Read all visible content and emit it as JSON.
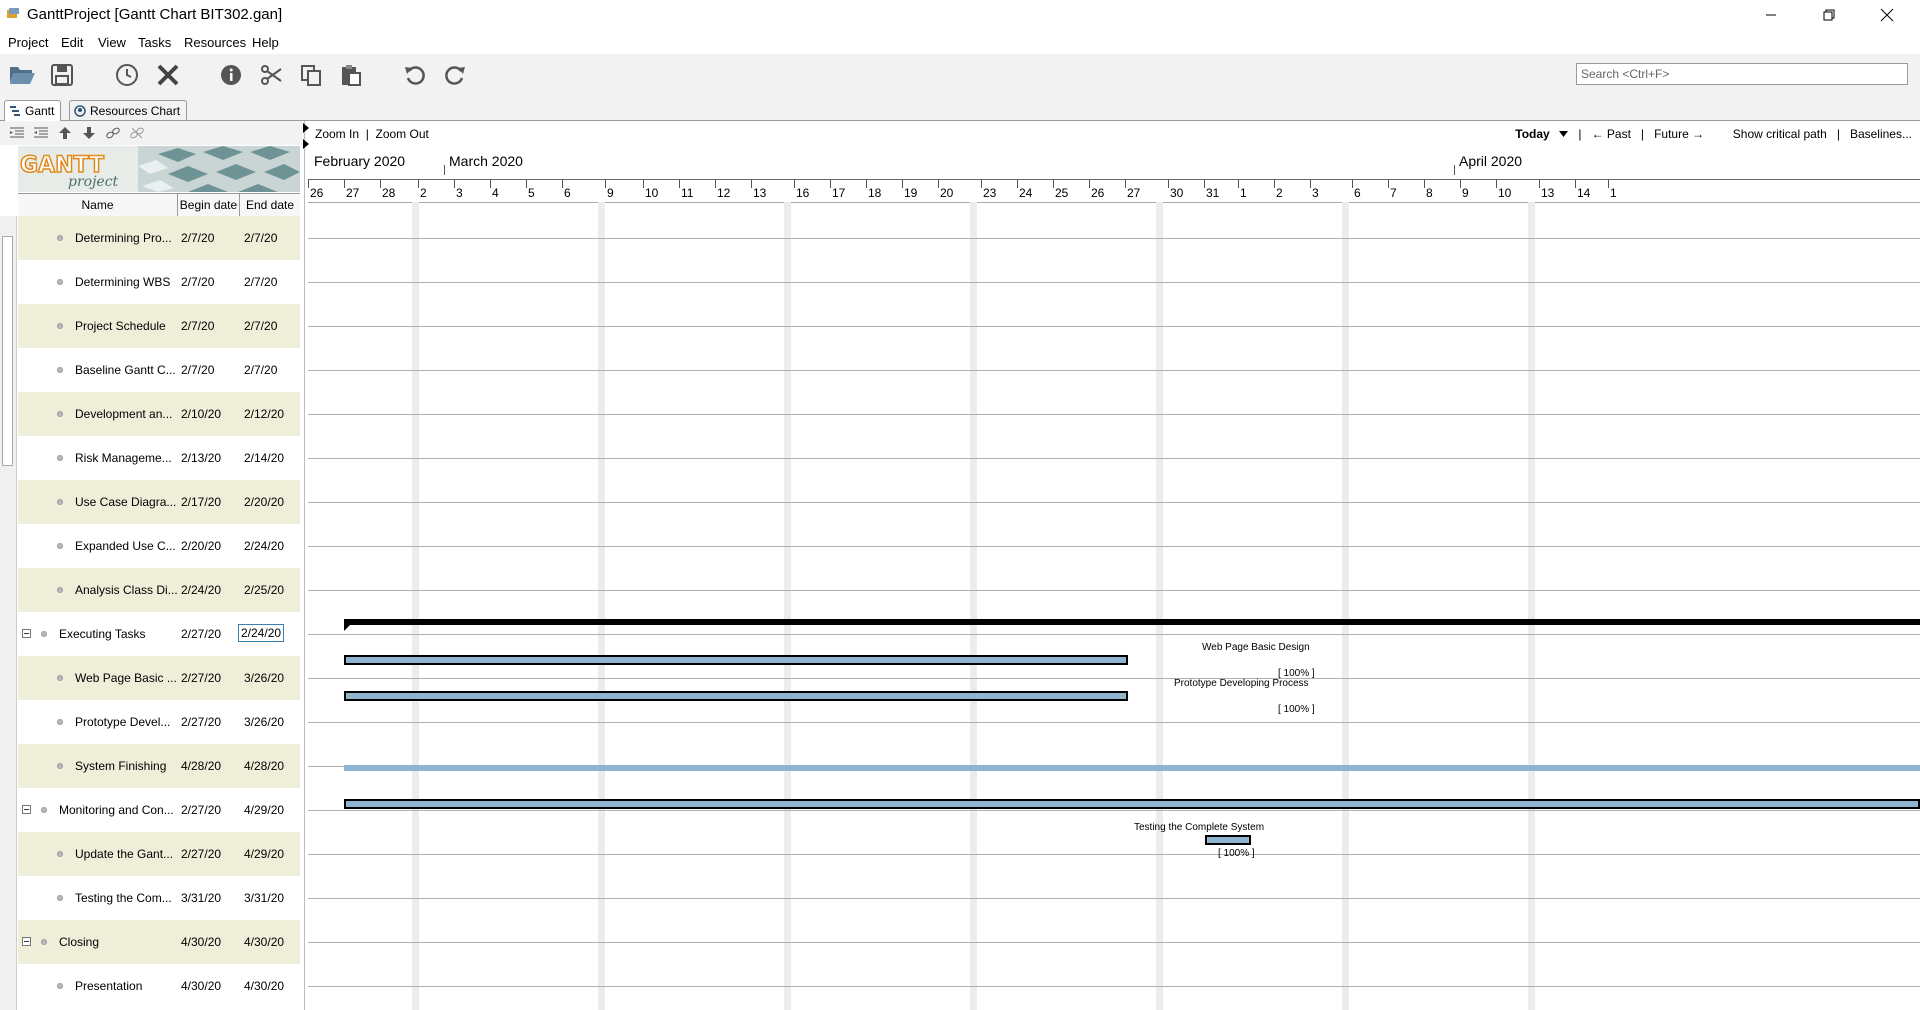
{
  "window": {
    "title": "GanttProject [Gantt Chart BIT302.gan]"
  },
  "menu": [
    "Project",
    "Edit",
    "View",
    "Tasks",
    "Resources",
    "Help"
  ],
  "toolbar": {
    "buttons": [
      "open-icon",
      "save-icon",
      "history-icon",
      "delete-icon",
      "info-icon",
      "cut-icon",
      "copy-icon",
      "paste-icon",
      "undo-icon",
      "redo-icon"
    ],
    "search_placeholder": "Search <Ctrl+F>"
  },
  "tabs": [
    {
      "label": "Gantt",
      "active": true
    },
    {
      "label": "Resources Chart",
      "active": false
    }
  ],
  "logo": {
    "main": "GANTT",
    "sub": "project"
  },
  "table": {
    "headers": {
      "name": "Name",
      "begin": "Begin date",
      "end": "End date"
    },
    "rows": [
      {
        "name": "Determining Pro...",
        "begin": "2/7/20",
        "end": "2/7/20",
        "level": 1
      },
      {
        "name": "Determining WBS",
        "begin": "2/7/20",
        "end": "2/7/20",
        "level": 1
      },
      {
        "name": "Project Schedule",
        "begin": "2/7/20",
        "end": "2/7/20",
        "level": 1
      },
      {
        "name": "Baseline Gantt C...",
        "begin": "2/7/20",
        "end": "2/7/20",
        "level": 1
      },
      {
        "name": "Development an...",
        "begin": "2/10/20",
        "end": "2/12/20",
        "level": 1
      },
      {
        "name": "Risk Manageme...",
        "begin": "2/13/20",
        "end": "2/14/20",
        "level": 1
      },
      {
        "name": "Use Case Diagra...",
        "begin": "2/17/20",
        "end": "2/20/20",
        "level": 1
      },
      {
        "name": "Expanded Use C...",
        "begin": "2/20/20",
        "end": "2/24/20",
        "level": 1
      },
      {
        "name": "Analysis Class Di...",
        "begin": "2/24/20",
        "end": "2/25/20",
        "level": 1
      },
      {
        "name": "Executing Tasks",
        "begin": "2/27/20",
        "end": "2/24/20",
        "level": 0,
        "editing_end": true
      },
      {
        "name": "Web Page Basic ...",
        "begin": "2/27/20",
        "end": "3/26/20",
        "level": 1
      },
      {
        "name": "Prototype Devel...",
        "begin": "2/27/20",
        "end": "3/26/20",
        "level": 1
      },
      {
        "name": "System Finishing",
        "begin": "4/28/20",
        "end": "4/28/20",
        "level": 1
      },
      {
        "name": "Monitoring and Con...",
        "begin": "2/27/20",
        "end": "4/29/20",
        "level": 0
      },
      {
        "name": "Update the Gant...",
        "begin": "2/27/20",
        "end": "4/29/20",
        "level": 1
      },
      {
        "name": "Testing the Com...",
        "begin": "3/31/20",
        "end": "3/31/20",
        "level": 1
      },
      {
        "name": "Closing",
        "begin": "4/30/20",
        "end": "4/30/20",
        "level": 0
      },
      {
        "name": "Presentation",
        "begin": "4/30/20",
        "end": "4/30/20",
        "level": 1
      }
    ]
  },
  "chart": {
    "zoom_in": "Zoom In",
    "zoom_out": "Zoom Out",
    "today": "Today",
    "past": "← Past",
    "future": "Future →",
    "critical": "Show critical path",
    "baselines": "Baselines...",
    "months": [
      "February 2020",
      "March 2020",
      "April 2020"
    ],
    "days": [
      "26",
      "27",
      "28",
      "2",
      "3",
      "4",
      "5",
      "6",
      "9",
      "10",
      "11",
      "12",
      "13",
      "16",
      "17",
      "18",
      "19",
      "20",
      "23",
      "24",
      "25",
      "26",
      "27",
      "30",
      "31",
      "1",
      "2",
      "3",
      "6",
      "7",
      "8",
      "9",
      "10",
      "13",
      "14",
      "1"
    ],
    "bars": [
      {
        "label": "Web Page Basic Design",
        "percent": "[ 100% ]"
      },
      {
        "label": "Prototype Developing Process",
        "percent": "[ 100% ]"
      },
      {
        "label": "Testing the Complete System",
        "percent": "[ 100% ]"
      }
    ]
  }
}
